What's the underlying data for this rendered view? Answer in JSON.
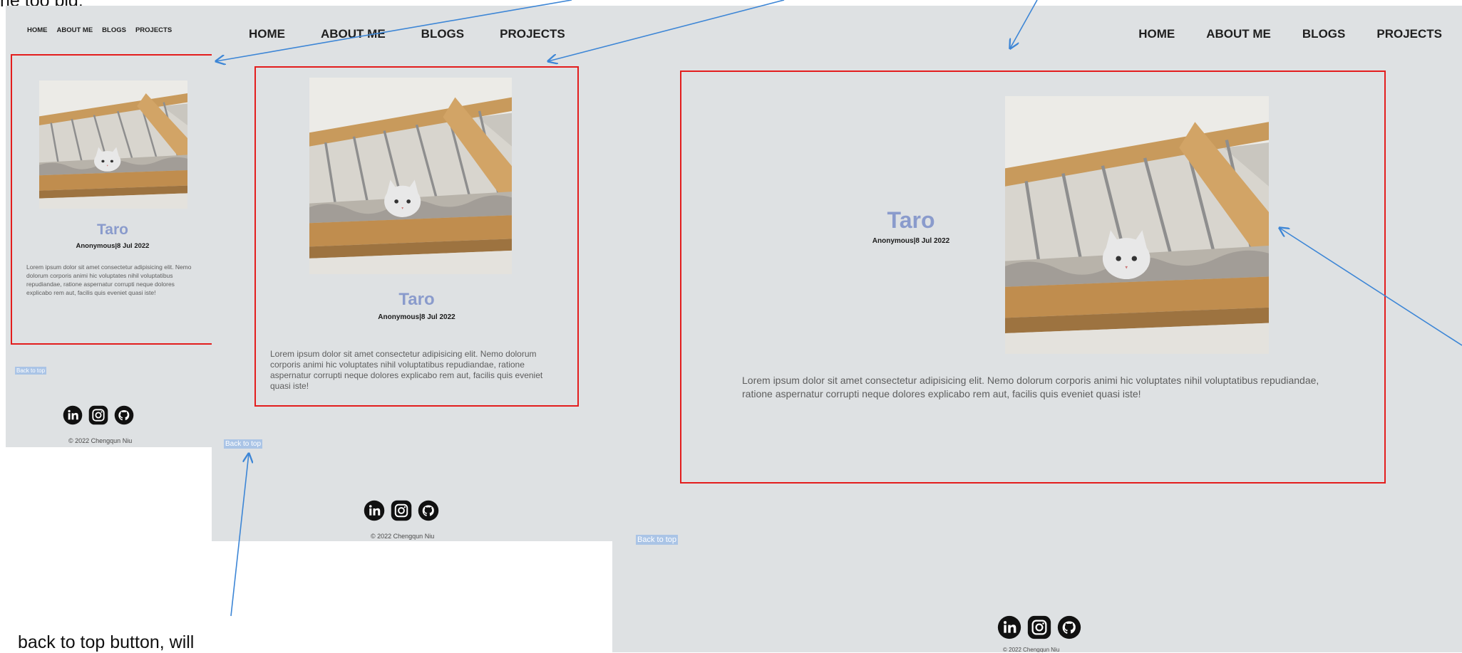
{
  "annotations": {
    "top_note": "ne too big.",
    "bottom_note": "back to top button, will"
  },
  "nav": [
    "HOME",
    "ABOUT ME",
    "BLOGS",
    "PROJECTS"
  ],
  "post": {
    "title": "Taro",
    "meta": "Anonymous|8 Jul 2022",
    "body": "Lorem ipsum dolor sit amet consectetur adipisicing elit. Nemo dolorum corporis animi hic voluptates nihil voluptatibus repudiandae, ratione aspernatur corrupti neque dolores explicabo rem aut, facilis quis eveniet quasi iste!"
  },
  "back_to_top": "Back to top",
  "socials": [
    "linkedin-icon",
    "instagram-icon",
    "github-icon"
  ],
  "copyright": "© 2022 Chengqun Niu",
  "colors": {
    "page_bg": "#dee1e3",
    "highlight_border": "#e31d1d",
    "title": "#8a9bcc",
    "arrow": "#3d86d6",
    "back_to_top_bg": "#aac4e6"
  }
}
